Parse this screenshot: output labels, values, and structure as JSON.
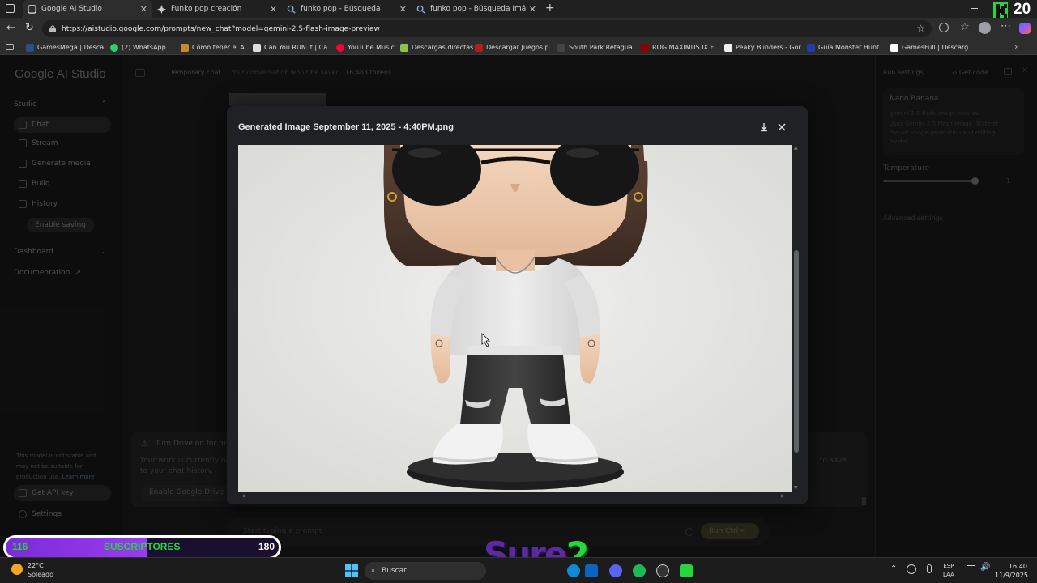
{
  "tabs": [
    {
      "title": "Google AI Studio",
      "active": true,
      "icon": "ai-studio-icon"
    },
    {
      "title": "Funko pop creación",
      "active": false,
      "icon": "gemini-icon"
    },
    {
      "title": "funko pop - Búsqueda",
      "active": false,
      "icon": "search-icon"
    },
    {
      "title": "funko pop - Búsqueda Imágenes",
      "active": false,
      "icon": "search-icon"
    }
  ],
  "address": {
    "url": "https://aistudio.google.com/prompts/new_chat?model=gemini-2.5-flash-image-preview"
  },
  "bookmarks": [
    "GamesMega | Desca...",
    "(2) WhatsApp",
    "Cómo tener el A...",
    "Can You RUN It | Ca...",
    "YouTube Music",
    "Descargas directas",
    "Descargar Juegos p...",
    "South Park Retagua...",
    "ROG MAXIMUS IX F...",
    "Peaky Blinders - Gor...",
    "Guía Monster Hunt...",
    "GamesFull | Descarg..."
  ],
  "app": {
    "logo": "Google AI Studio",
    "topbar": {
      "chat_title": "Temporary chat",
      "notice": "Your conversation won't be saved",
      "tokens": "16,483 tokens"
    },
    "nav": {
      "studio": "Studio",
      "chat": "Chat",
      "stream": "Stream",
      "generate_media": "Generate media",
      "build": "Build",
      "history": "History",
      "enable_saving": "Enable saving",
      "dashboard": "Dashboard",
      "documentation": "Documentation",
      "get_api_key": "Get API key",
      "settings": "Settings"
    },
    "disclaimer": [
      "This model is not stable and",
      "may not be suitable for",
      "production use."
    ],
    "disclaimer_link": "Learn more",
    "drive_banner": {
      "title": "Turn Drive on for ful",
      "body1": "Your work is currently no",
      "body2": "to your chat history.",
      "button": "Enable Google Drive",
      "right": "to save"
    },
    "prompt": {
      "placeholder": "Start typing a prompt",
      "run": "Run",
      "run_shortcut": "Ctrl ↵"
    },
    "right": {
      "run_settings": "Run settings",
      "get_code": "Get code",
      "model_name": "Nano Banana",
      "model_id": "gemini-2.5-flash-image-preview",
      "model_desc": [
        "Uses Gemini 2.5 Flash Image. State-of",
        "the-art image generation and editing",
        "model."
      ],
      "temperature_label": "Temperature",
      "temperature_value": "1",
      "advanced": "Advanced settings"
    }
  },
  "modal": {
    "title": "Generated Image September 11, 2025 - 4:40PM.png",
    "download_icon": "download-icon",
    "close_icon": "close-icon",
    "image_alt": "funko-pop-figure-image"
  },
  "overlay": {
    "sub_left": "116",
    "sub_label": "SUSCRIPTORES",
    "sub_right": "180",
    "sub_progress": 0.52,
    "brand_a": "Sure",
    "brand_b": "2",
    "badge_num": "20"
  },
  "taskbar": {
    "weather_temp": "22°C",
    "weather_desc": "Soleado",
    "search": "Buscar",
    "lang1": "ESP",
    "lang2": "LAA",
    "time": "16:40",
    "date": "11/9/2025"
  },
  "colors": {
    "accent": "#8ab4f8",
    "sub_fill": "#9a3bf0",
    "sub_text": "#25d63c",
    "k_logo": "#25d63c"
  }
}
